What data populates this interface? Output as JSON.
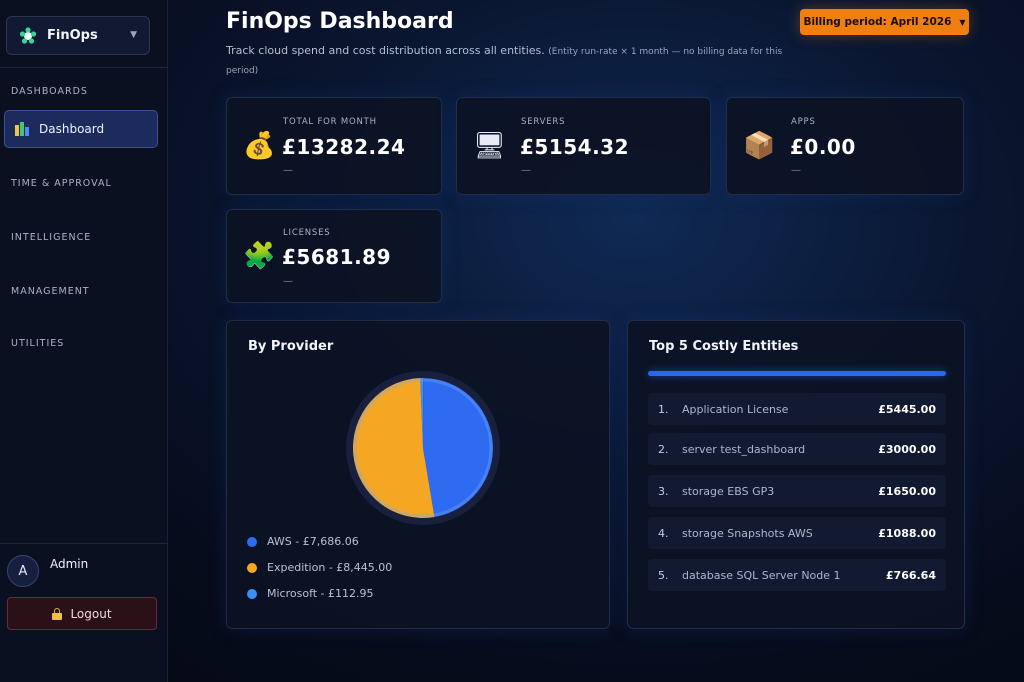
{
  "sidebar": {
    "app_name": "FinOps",
    "sections": [
      "DASHBOARDS",
      "TIME & APPROVAL",
      "INTELLIGENCE",
      "MANAGEMENT",
      "UTILITIES"
    ],
    "active_item": {
      "label": "Dashboard",
      "icon": "bar-chart-icon"
    },
    "user": {
      "initial": "A",
      "name": "Admin"
    },
    "logout_label": "Logout"
  },
  "header": {
    "title": "FinOps Dashboard",
    "subtitle": "Track cloud spend and cost distribution across all entities.",
    "subtitle_note": "(Entity run-rate × 1 month — no billing data for this period)",
    "billing_period_label": "Billing period: April 2026"
  },
  "stats": [
    {
      "label": "TOTAL FOR MONTH",
      "value": "£13282.24",
      "sub": "—",
      "icon": "money-bag-icon",
      "glyph": "💰"
    },
    {
      "label": "SERVERS",
      "value": "£5154.32",
      "sub": "—",
      "icon": "monitor-icon",
      "glyph": "🖥"
    },
    {
      "label": "APPS",
      "value": "£0.00",
      "sub": "—",
      "icon": "package-icon",
      "glyph": "📦"
    },
    {
      "label": "LICENSES",
      "value": "£5681.89",
      "sub": "—",
      "icon": "puzzle-icon",
      "glyph": "🧩"
    }
  ],
  "by_provider": {
    "title": "By Provider",
    "legend": [
      {
        "label": "AWS - £7,686.06",
        "color": "#2f6bf0"
      },
      {
        "label": "Expedition - £8,445.00",
        "color": "#f5a623"
      },
      {
        "label": "Microsoft - £112.95",
        "color": "#3d8ef5"
      }
    ]
  },
  "chart_data": {
    "type": "pie",
    "categories": [
      "AWS",
      "Expedition",
      "Microsoft"
    ],
    "values": [
      7686.06,
      8445.0,
      112.95
    ],
    "colors": [
      "#2f6bf0",
      "#f5a623",
      "#3d8ef5"
    ],
    "title": ""
  },
  "top_entities": {
    "title": "Top 5 Costly Entities",
    "rows": [
      {
        "rank": "1.",
        "name": "Application License",
        "cost": "£5445.00"
      },
      {
        "rank": "2.",
        "name": "server test_dashboard",
        "cost": "£3000.00"
      },
      {
        "rank": "3.",
        "name": "storage EBS GP3",
        "cost": "£1650.00"
      },
      {
        "rank": "4.",
        "name": "storage Snapshots AWS",
        "cost": "£1088.00"
      },
      {
        "rank": "5.",
        "name": "database SQL Server Node 1",
        "cost": "£766.64"
      }
    ]
  }
}
